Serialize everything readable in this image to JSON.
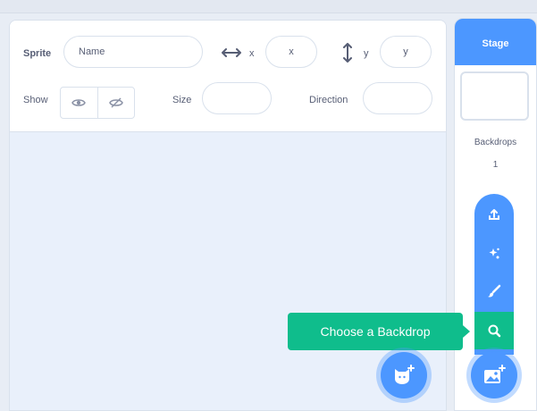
{
  "sprite_info": {
    "sprite_label": "Sprite",
    "name_placeholder": "Name",
    "x_label": "x",
    "x_placeholder": "x",
    "y_label": "y",
    "y_placeholder": "y",
    "show_label": "Show",
    "size_label": "Size",
    "direction_label": "Direction"
  },
  "stage": {
    "header": "Stage",
    "backdrops_label": "Backdrops",
    "backdrops_count": "1"
  },
  "backdrop_menu": {
    "items": [
      "upload-icon",
      "surprise-icon",
      "paint-icon",
      "search-icon"
    ],
    "tooltip": "Choose a Backdrop"
  },
  "colors": {
    "blue": "#4c97ff",
    "green": "#0fbd8c",
    "text": "#575e75"
  }
}
